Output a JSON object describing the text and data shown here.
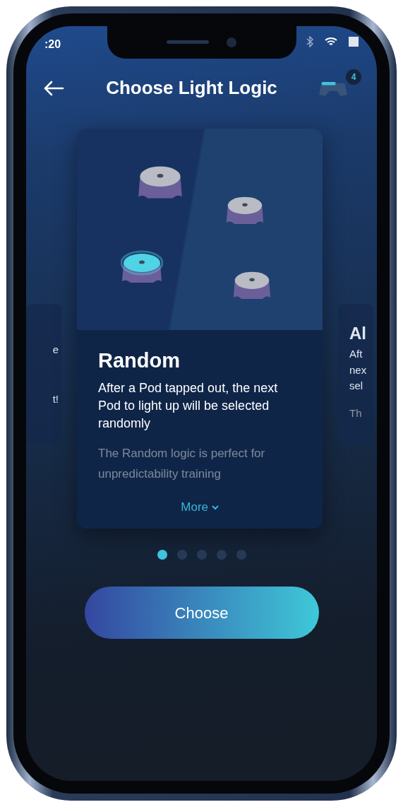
{
  "status_bar": {
    "time": ":20"
  },
  "header": {
    "title": "Choose Light Logic",
    "controller_badge": "4"
  },
  "left_card": {
    "lines": [
      "e",
      "t!"
    ]
  },
  "card": {
    "title": "Random",
    "description": "After a Pod tapped out, the next Pod to light up will be selected randomly",
    "details": "The Random logic is perfect for unpredictability training",
    "more": "More",
    "pods": [
      {
        "lit": false
      },
      {
        "lit": false
      },
      {
        "lit": true
      },
      {
        "lit": false
      }
    ]
  },
  "right_card": {
    "title": "Al",
    "lines": [
      "Aft",
      "nex",
      "sel"
    ],
    "details": "Th"
  },
  "pager": [
    {
      "selected": true
    },
    {
      "selected": false
    },
    {
      "selected": false
    },
    {
      "selected": false
    },
    {
      "selected": false
    }
  ],
  "button": "Choose"
}
